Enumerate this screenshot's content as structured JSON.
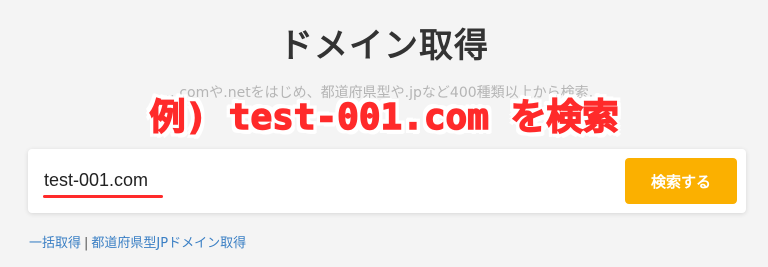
{
  "header": {
    "title": "ドメイン取得",
    "subtitle": "…comや.netをはじめ、都道府県型や.jpなど400種類以上から検索…"
  },
  "overlay": {
    "text": "例) test-001.com を検索",
    "color": "#ff2a2a"
  },
  "search": {
    "value": "test-001.com",
    "button_label": "検索する",
    "button_color": "#fbb000"
  },
  "links": {
    "bulk": "一括取得",
    "separator": "|",
    "prefecture": "都道府県型JPドメイン取得"
  }
}
